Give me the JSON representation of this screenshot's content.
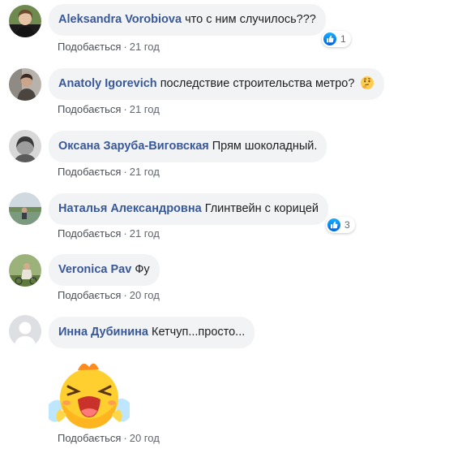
{
  "comments": [
    {
      "author": "Aleksandra Vorobiova",
      "text": "что с ним случилось???",
      "like_label": "Подобається",
      "time": "21 год",
      "reactions": "1"
    },
    {
      "author": "Anatoly Igorevich",
      "text": "последствие строительства метро?",
      "emoji": "thinking-face",
      "like_label": "Подобається",
      "time": "21 год"
    },
    {
      "author": "Оксана Заруба-Виговская",
      "text": "Прям шоколадный.",
      "like_label": "Подобається",
      "time": "21 год"
    },
    {
      "author": "Наталья Александровна",
      "text": "Глинтвейн с корицей",
      "like_label": "Подобається",
      "time": "21 год",
      "reactions": "3"
    },
    {
      "author": "Veronica Pav",
      "text": "Фу",
      "like_label": "Подобається",
      "time": "20 год"
    },
    {
      "author": "Инна Дубинина",
      "text": "Кетчуп...просто...",
      "like_label": "Подобається",
      "time": "20 год",
      "sticker": "crying-chick-sticker"
    }
  ],
  "colors": {
    "author": "#385898",
    "bubble": "#f2f3f5",
    "meta": "#606770",
    "like_badge": "#1877f2"
  },
  "icons": {
    "like": "thumbs-up-icon",
    "emoji": "thinking-face-icon",
    "sticker": "crying-chick-sticker"
  }
}
